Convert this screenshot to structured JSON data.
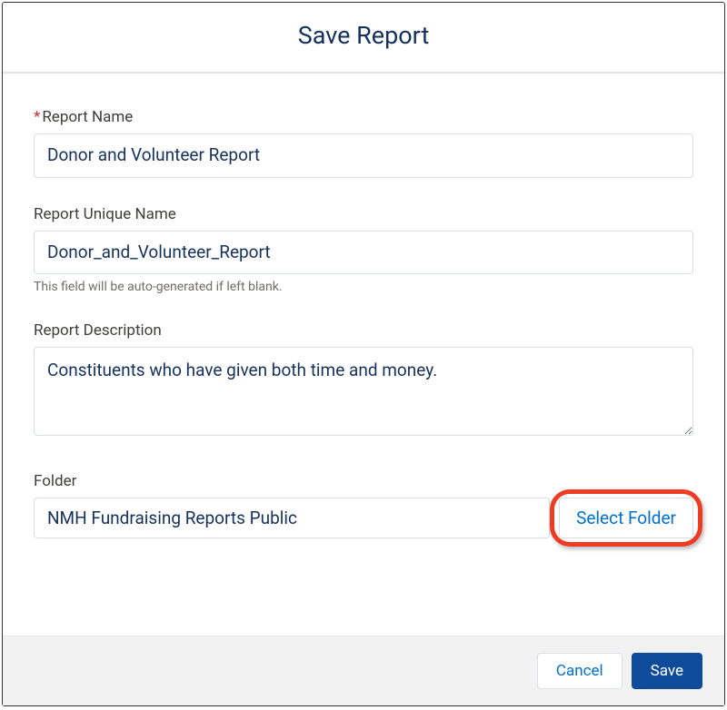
{
  "modal": {
    "title": "Save Report"
  },
  "fields": {
    "report_name": {
      "label": "Report Name",
      "value": "Donor and Volunteer Report",
      "required": true
    },
    "unique_name": {
      "label": "Report Unique Name",
      "value": "Donor_and_Volunteer_Report",
      "help_text": "This field will be auto-generated if left blank."
    },
    "description": {
      "label": "Report Description",
      "value": "Constituents who have given both time and money."
    },
    "folder": {
      "label": "Folder",
      "value": "NMH Fundraising Reports Public",
      "select_button": "Select Folder"
    }
  },
  "buttons": {
    "cancel": "Cancel",
    "save": "Save"
  }
}
